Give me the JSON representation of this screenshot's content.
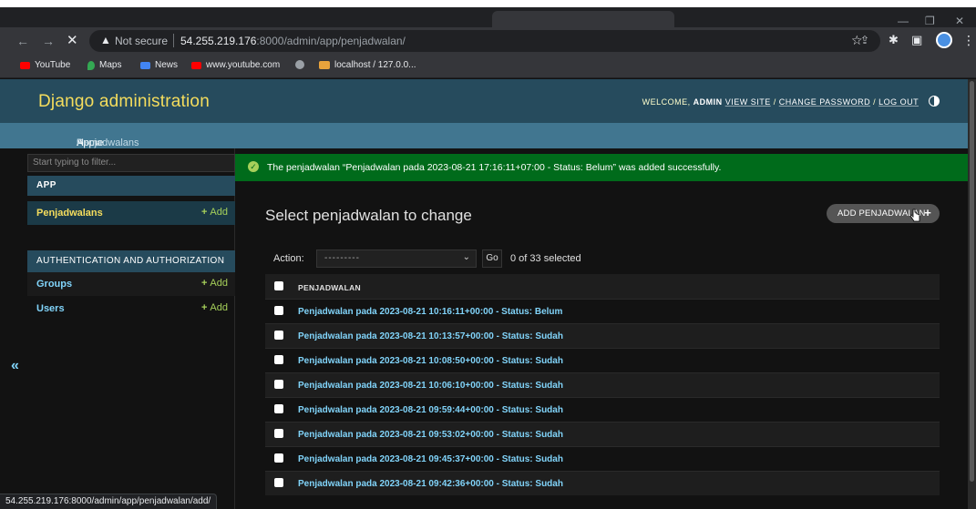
{
  "browser": {
    "not_secure": "Not secure",
    "url_host": "54.255.219.176",
    "url_rest": ":8000/admin/app/penjadwalan/",
    "bookmarks": [
      {
        "label": "YouTube",
        "icon": "youtube-icon"
      },
      {
        "label": "Maps",
        "icon": "maps-icon"
      },
      {
        "label": "News",
        "icon": "news-icon"
      },
      {
        "label": "www.youtube.com",
        "icon": "youtube-icon"
      },
      {
        "label": "",
        "icon": "globe-icon"
      },
      {
        "label": "localhost / 127.0.0...",
        "icon": "phpmyadmin-icon"
      }
    ],
    "status_url": "54.255.219.176:8000/admin/app/penjadwalan/add/"
  },
  "header": {
    "brand": "Django administration",
    "welcome": "WELCOME,",
    "user": "ADMIN",
    "view_site": "VIEW SITE",
    "change_password": "CHANGE PASSWORD",
    "log_out": "LOG OUT",
    "sep": "/"
  },
  "breadcrumbs": {
    "home": "Home",
    "app": "App",
    "current": "Penjadwalans",
    "sep": "›"
  },
  "sidebar": {
    "filter_placeholder": "Start typing to filter...",
    "apps": [
      {
        "caption": "APP",
        "models": [
          {
            "name": "Penjadwalans",
            "add": "Add"
          }
        ]
      },
      {
        "caption": "AUTHENTICATION AND AUTHORIZATION",
        "models": [
          {
            "name": "Groups",
            "add": "Add"
          },
          {
            "name": "Users",
            "add": "Add"
          }
        ]
      }
    ],
    "collapse": "«"
  },
  "message": "The penjadwalan “Penjadwalan pada 2023-08-21 17:16:11+07:00 - Status: Belum” was added successfully.",
  "content": {
    "title": "Select penjadwalan to change",
    "add_button": "ADD PENJADWALAN",
    "action_label": "Action:",
    "action_value": "---------",
    "go": "Go",
    "selected": "0 of 33 selected",
    "column": "PENJADWALAN",
    "rows": [
      "Penjadwalan pada 2023-08-21 10:16:11+00:00 - Status: Belum",
      "Penjadwalan pada 2023-08-21 10:13:57+00:00 - Status: Sudah",
      "Penjadwalan pada 2023-08-21 10:08:50+00:00 - Status: Sudah",
      "Penjadwalan pada 2023-08-21 10:06:10+00:00 - Status: Sudah",
      "Penjadwalan pada 2023-08-21 09:59:44+00:00 - Status: Sudah",
      "Penjadwalan pada 2023-08-21 09:53:02+00:00 - Status: Sudah",
      "Penjadwalan pada 2023-08-21 09:45:37+00:00 - Status: Sudah",
      "Penjadwalan pada 2023-08-21 09:42:36+00:00 - Status: Sudah"
    ]
  },
  "colors": {
    "header": "#264b5d",
    "breadcrumbs": "#417690",
    "brand": "#f5dd5d",
    "link": "#81d4fa",
    "success": "#006b1b",
    "add": "#a6d05a"
  }
}
